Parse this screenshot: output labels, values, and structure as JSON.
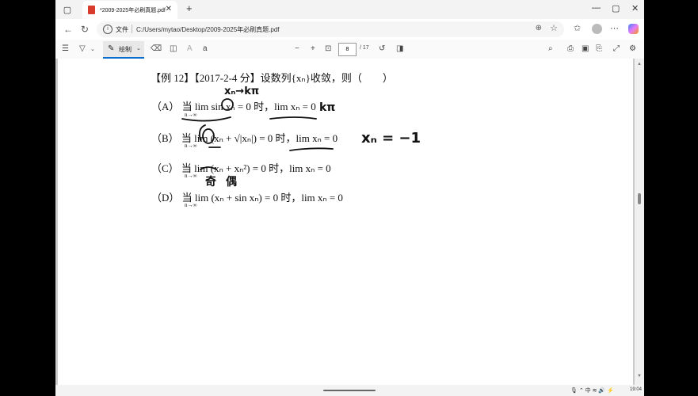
{
  "tab": {
    "title": "*2009-2025年必刷真题.pdf"
  },
  "address": {
    "label": "文件",
    "path": "C:/Users/mytao/Desktop/2009-2025年必刷真题.pdf"
  },
  "toolbar": {
    "draw_label": "绘制",
    "current_page": "8",
    "total_pages": "/ 17"
  },
  "problem": {
    "heading": "【例 12】【2017-2-4 分】设数列{xₙ}收敛，则（　　）",
    "options": [
      {
        "letter": "（A）",
        "text": "当 lim sin xₙ = 0 时，lim xₙ = 0"
      },
      {
        "letter": "（B）",
        "text": "当 lim (xₙ + √|xₙ|) = 0 时，lim xₙ = 0"
      },
      {
        "letter": "（C）",
        "text": "当 lim (xₙ + xₙ²) = 0 时，lim xₙ = 0"
      },
      {
        "letter": "（D）",
        "text": "当 lim (xₙ + sin xₙ) = 0 时，lim xₙ = 0"
      }
    ],
    "limit_subscript": "n→∞"
  },
  "annotations": {
    "a1": "xₙ→kπ",
    "a2": "kπ",
    "a3": "xₙ = −1",
    "a4": "奇",
    "a5": "偶"
  },
  "taskbar": {
    "clock": "19:04"
  }
}
